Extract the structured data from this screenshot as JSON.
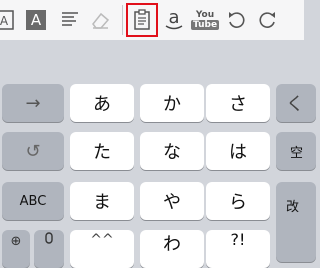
{
  "toolbar": {
    "items": [
      {
        "name": "text-format-icon"
      },
      {
        "name": "text-style-a-icon",
        "label": "A"
      },
      {
        "name": "align-lines-icon"
      },
      {
        "name": "eraser-icon"
      },
      {
        "name": "paste-clipboard-icon",
        "highlight_color": "#e10f1a"
      },
      {
        "name": "amazon-icon",
        "label": "a"
      },
      {
        "name": "youtube-icon",
        "label_top": "You",
        "label_bottom": "Tube"
      },
      {
        "name": "undo-icon"
      },
      {
        "name": "redo-icon"
      }
    ]
  },
  "keyboard": {
    "rows": [
      {
        "keys": [
          "→",
          "あ",
          "か",
          "さ",
          "く"
        ]
      },
      {
        "keys": [
          "↺",
          "た",
          "な",
          "は",
          "空"
        ]
      },
      {
        "keys": [
          "ABC",
          "ま",
          "や",
          "ら",
          "改"
        ]
      },
      {
        "keys": [
          "⊕",
          "🎙",
          "^^",
          "わ",
          "?!"
        ]
      }
    ]
  }
}
